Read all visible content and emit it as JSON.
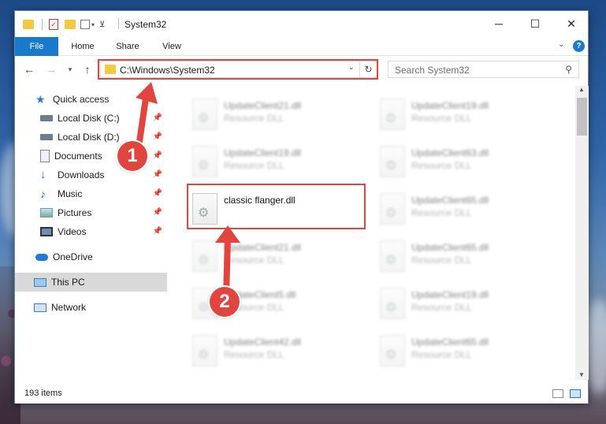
{
  "window": {
    "title": "System32"
  },
  "ribbon": {
    "tabs": [
      "File",
      "Home",
      "Share",
      "View"
    ]
  },
  "address": {
    "path": "C:\\Windows\\System32",
    "search_placeholder": "Search System32"
  },
  "navigation": {
    "items": [
      {
        "label": "Quick access",
        "icon": "star-icon"
      },
      {
        "label": "Local Disk (C:)",
        "icon": "drive-icon",
        "pinned": true
      },
      {
        "label": "Local Disk (D:)",
        "icon": "drive-icon",
        "pinned": true
      },
      {
        "label": "Documents",
        "icon": "documents-icon",
        "pinned": true
      },
      {
        "label": "Downloads",
        "icon": "download-icon",
        "pinned": true
      },
      {
        "label": "Music",
        "icon": "music-icon",
        "pinned": true
      },
      {
        "label": "Pictures",
        "icon": "pictures-icon",
        "pinned": true
      },
      {
        "label": "Videos",
        "icon": "videos-icon",
        "pinned": true
      },
      {
        "label": "OneDrive",
        "icon": "cloud-icon"
      },
      {
        "label": "This PC",
        "icon": "computer-icon",
        "selected": true
      },
      {
        "label": "Network",
        "icon": "network-icon"
      }
    ]
  },
  "files": [
    {
      "name": "UpdateClient21.dll",
      "type": "Resource DLL"
    },
    {
      "name": "UpdateClient19.dll",
      "type": "Resource DLL"
    },
    {
      "name": "UpdateClient19.dll",
      "type": "Resource DLL"
    },
    {
      "name": "UpdateClient63.dll",
      "type": "Resource DLL"
    },
    {
      "name": "classic flanger.dll",
      "type": ""
    },
    {
      "name": "UpdateClient65.dll",
      "type": "Resource DLL"
    },
    {
      "name": "UpdateClient21.dll",
      "type": "Resource DLL"
    },
    {
      "name": "UpdateClient65.dll",
      "type": "Resource DLL"
    },
    {
      "name": "UpdateClient5.dll",
      "type": "Resource DLL"
    },
    {
      "name": "UpdateClient19.dll",
      "type": "Resource DLL"
    },
    {
      "name": "UpdateClient42.dll",
      "type": "Resource DLL"
    },
    {
      "name": "UpdateClient65.dll",
      "type": "Resource DLL"
    }
  ],
  "status": {
    "item_count": "193 items"
  },
  "annotations": {
    "step1": "1",
    "step2": "2"
  },
  "colors": {
    "accent": "#1979ca",
    "highlight": "#e0463f"
  }
}
